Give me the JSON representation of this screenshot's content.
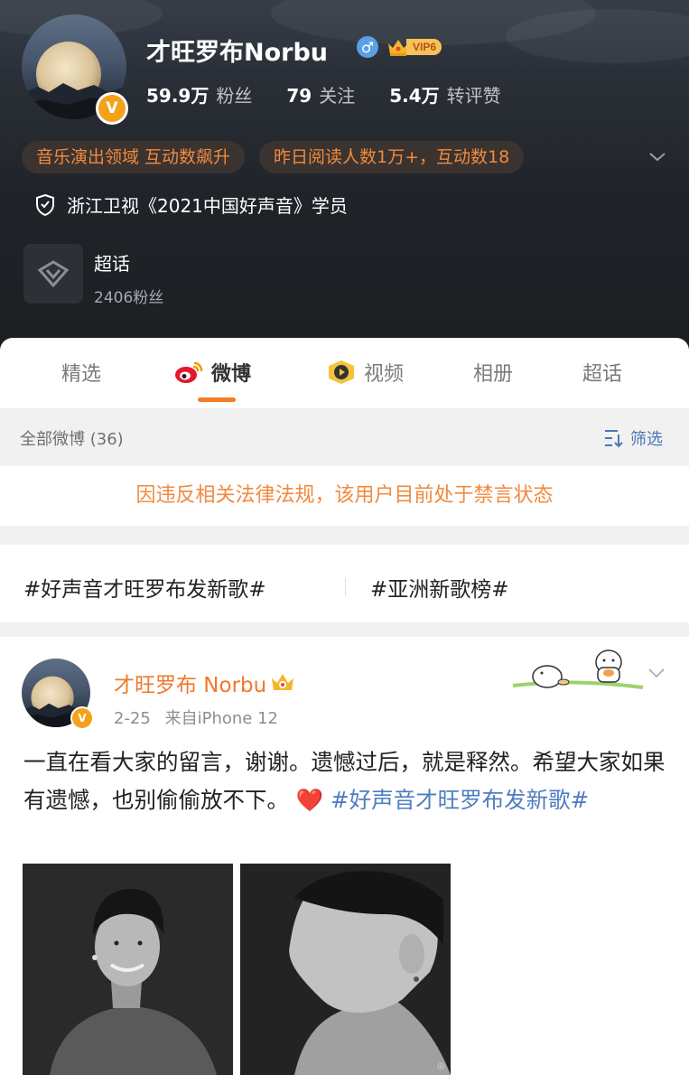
{
  "profile": {
    "name": "才旺罗布Norbu",
    "vip_label": "VIP6",
    "stats": [
      {
        "value": "59.9万",
        "label": "粉丝"
      },
      {
        "value": "79",
        "label": "关注"
      },
      {
        "value": "5.4万",
        "label": "转评赞"
      }
    ],
    "tags": [
      "音乐演出领域 互动数飙升",
      "昨日阅读人数1万+，互动数18"
    ],
    "certification": "浙江卫视《2021中国好声音》学员",
    "supertopic": {
      "title": "超话",
      "fans": "2406粉丝"
    }
  },
  "tabs": [
    "精选",
    "微博",
    "视频",
    "相册",
    "超话"
  ],
  "active_tab": "微博",
  "filter_bar": {
    "all_posts": "全部微博 (36)",
    "filter_label": "筛选"
  },
  "notice": "因违反相关法律法规，该用户目前处于禁言状态",
  "hashtags": [
    "#好声音才旺罗布发新歌#",
    "#亚洲新歌榜#"
  ],
  "post": {
    "author": "才旺罗布 Norbu",
    "date": "2-25",
    "source": "来自iPhone 12",
    "text": "一直在看大家的留言，谢谢。遗憾过后，就是释然。希望大家如果有遗憾，也别偷偷放不下。",
    "emoji": "❤️",
    "link": "#好声音才旺罗布发新歌#"
  },
  "colors": {
    "accent": "#f08a3e",
    "link": "#4f7dc0",
    "vip_gold": "#f7c25a"
  }
}
